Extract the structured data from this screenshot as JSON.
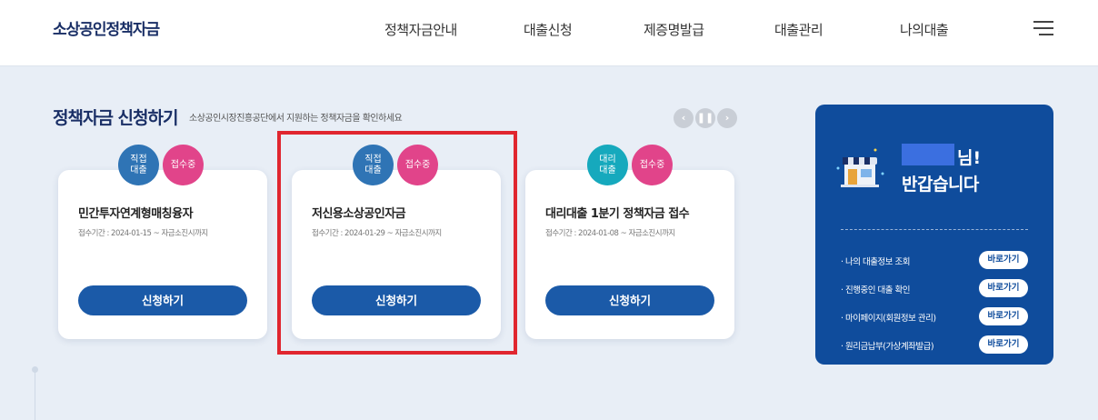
{
  "header": {
    "logo": "소상공인정책자금",
    "nav": [
      "정책자금안내",
      "대출신청",
      "제증명발급",
      "대출관리",
      "나의대출"
    ]
  },
  "section": {
    "title": "정책자금 신청하기",
    "subtitle": "소상공인시장진흥공단에서 지원하는 정책자금을 확인하세요"
  },
  "cards": [
    {
      "type_badge": "직접\n대출",
      "status_badge": "접수중",
      "title": "민간투자연계형매칭융자",
      "date": "접수기간 : 2024-01-15 ~ 자금소진시까지",
      "button": "신청하기"
    },
    {
      "type_badge": "직접\n대출",
      "status_badge": "접수중",
      "title": "저신용소상공인자금",
      "date": "접수기간 : 2024-01-29 ~ 자금소진시까지",
      "button": "신청하기"
    },
    {
      "type_badge": "대리\n대출",
      "status_badge": "접수중",
      "title": "대리대출 1분기 정책자금 접수",
      "date": "접수기간 : 2024-01-08 ~ 자금소진시까지",
      "button": "신청하기"
    }
  ],
  "panel": {
    "greeting_suffix": "님!",
    "greeting_line2": "반갑습니다",
    "links": [
      {
        "label": "· 나의 대출정보 조회",
        "button": "바로가기"
      },
      {
        "label": "· 진행중인 대출 확인",
        "button": "바로가기"
      },
      {
        "label": "· 마이페이지(회원정보 관리)",
        "button": "바로가기"
      },
      {
        "label": "· 원리금납부(가상계좌발급)",
        "button": "바로가기"
      }
    ]
  },
  "colors": {
    "brand": "#1a2f66",
    "button": "#1b5aa8",
    "status_badge": "#e1448a",
    "panel": "#0f4c9c",
    "highlight": "#e0262f"
  }
}
